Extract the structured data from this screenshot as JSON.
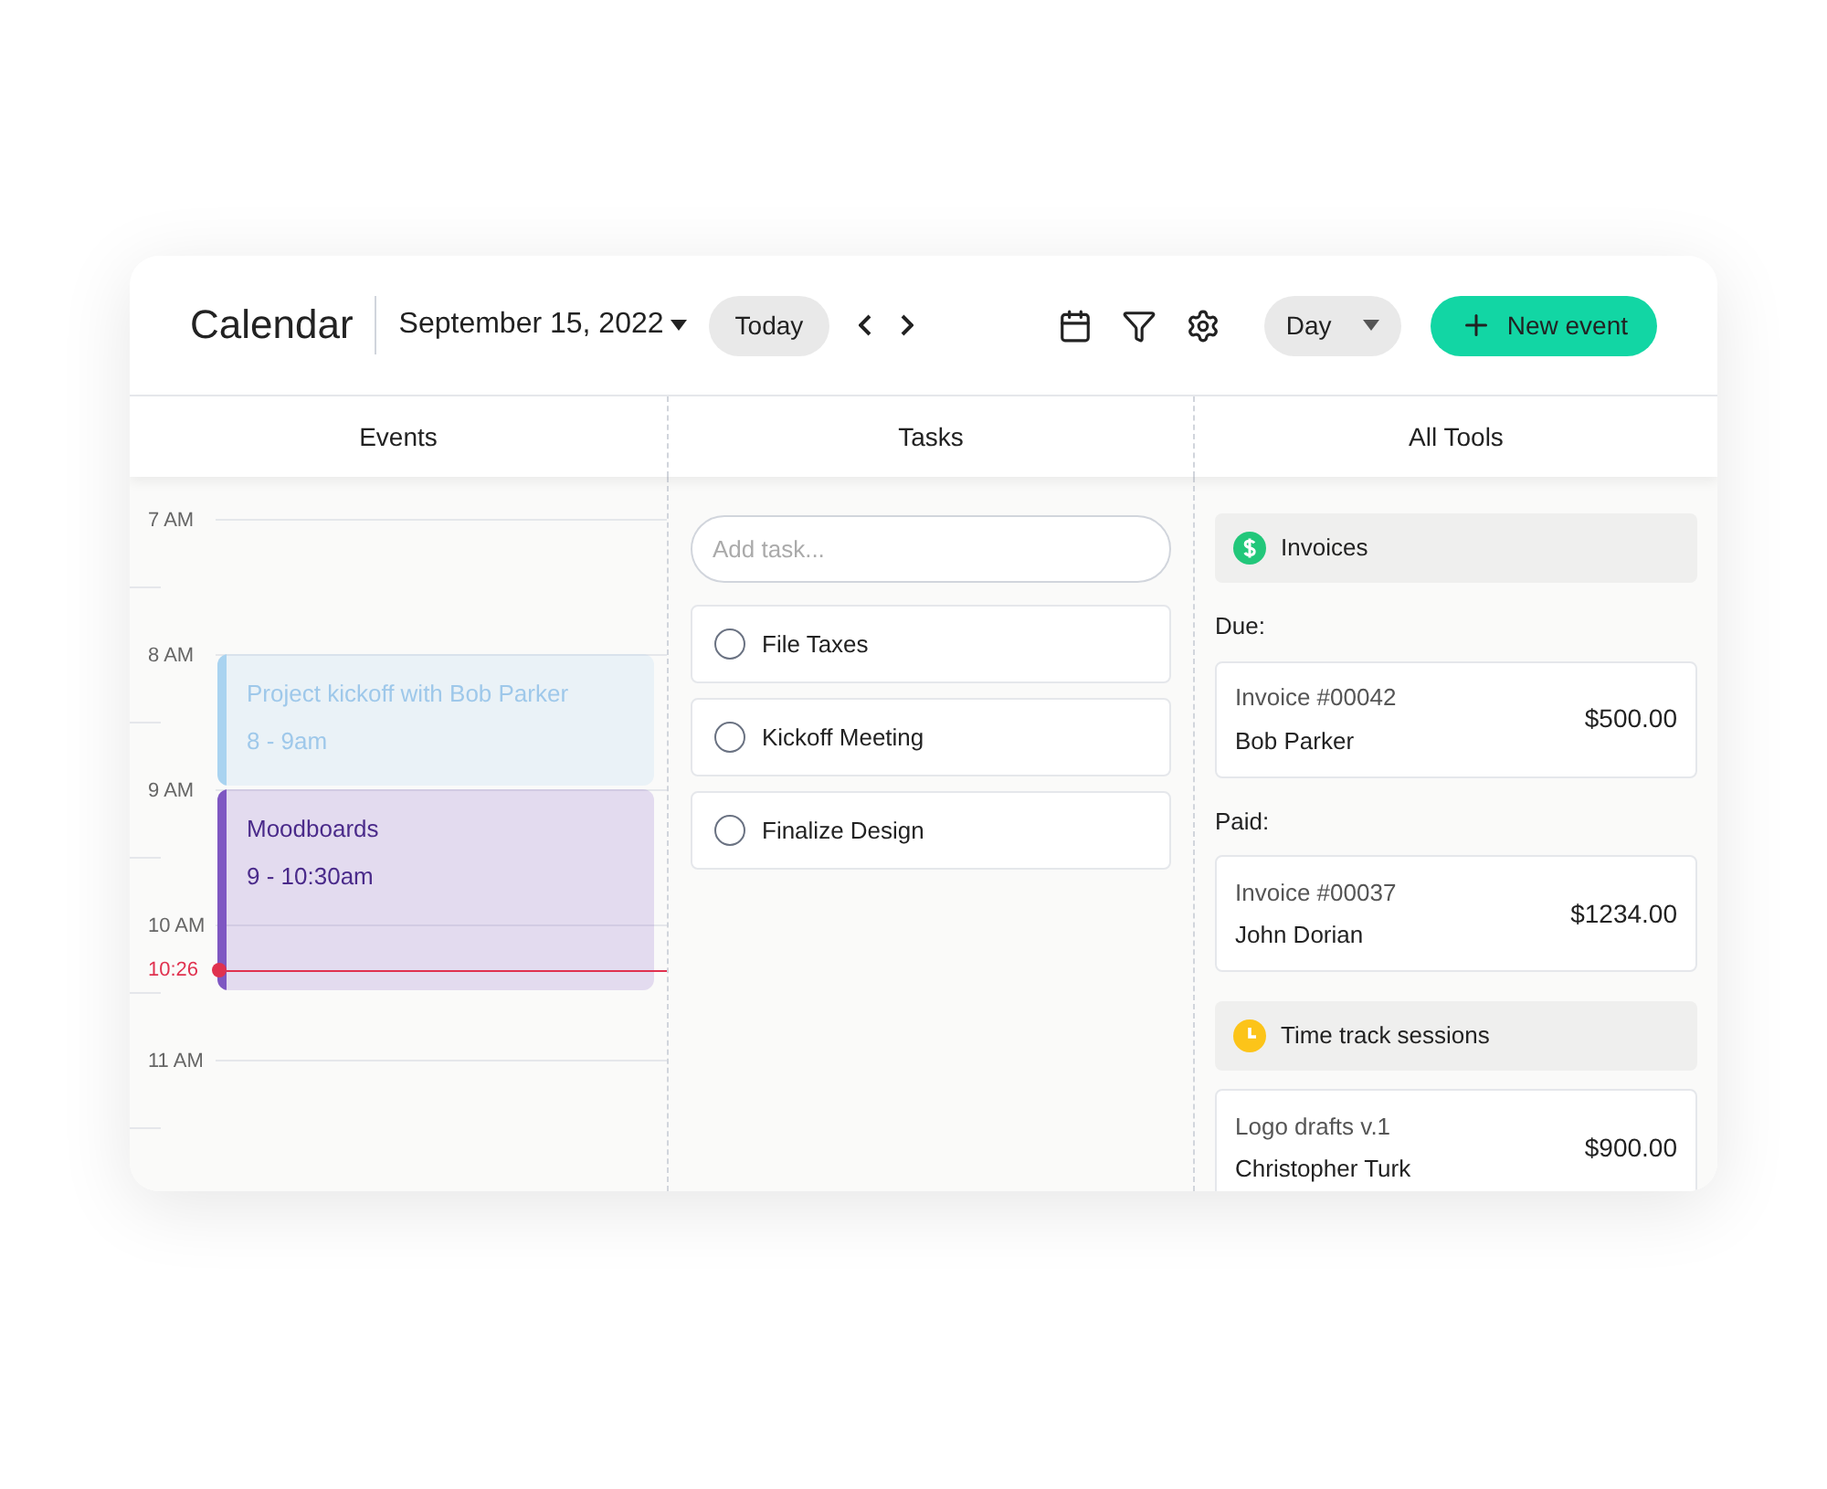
{
  "header": {
    "title": "Calendar",
    "date": "September 15, 2022",
    "today_button": "Today",
    "view_select": "Day",
    "new_event_button": "New event"
  },
  "columns": [
    {
      "label": "Events"
    },
    {
      "label": "Tasks"
    },
    {
      "label": "All Tools"
    }
  ],
  "timeline": {
    "hours": [
      "7 AM",
      "8 AM",
      "9 AM",
      "10 AM",
      "11 AM"
    ],
    "now_label": "10:26",
    "events": [
      {
        "title": "Project kickoff with Bob Parker",
        "time": "8 - 9am",
        "color": "#a9d3f0",
        "kind": "tentative"
      },
      {
        "title": "Moodboards",
        "time": "9 - 10:30am",
        "color": "#7e57c2",
        "kind": "confirmed"
      }
    ]
  },
  "tasks": {
    "placeholder": "Add task...",
    "items": [
      {
        "label": "File Taxes",
        "checked": false
      },
      {
        "label": "Kickoff Meeting",
        "checked": false
      },
      {
        "label": "Finalize Design",
        "checked": false
      }
    ]
  },
  "tools": {
    "sections": [
      {
        "kind": "invoices",
        "title": "Invoices",
        "groups": [
          {
            "label": "Due:",
            "items": [
              {
                "title": "Invoice #00042",
                "name": "Bob Parker",
                "amount": "$500.00"
              }
            ]
          },
          {
            "label": "Paid:",
            "items": [
              {
                "title": "Invoice #00037",
                "name": "John Dorian",
                "amount": "$1234.00"
              }
            ]
          }
        ]
      },
      {
        "kind": "time",
        "title": "Time track sessions",
        "groups": [
          {
            "items": [
              {
                "title": "Logo drafts v.1",
                "name": "Christopher Turk",
                "amount": "$900.00"
              }
            ]
          }
        ]
      }
    ]
  }
}
